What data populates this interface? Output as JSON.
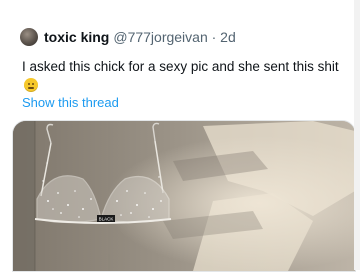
{
  "tweet": {
    "display_name": "toxic king",
    "handle_time": "@777jorgeivan · 2d",
    "text": "I asked this chick for a sexy pic and she sent this shit",
    "show_thread": "Show this thread",
    "emoji_icon": "slightly-frowning-face-icon"
  },
  "media": {
    "description_icon": "photo-bra-on-door",
    "tag_text": "BLACK"
  },
  "colors": {
    "link": "#1d9bf0",
    "name": "#0f1419",
    "meta": "#536471"
  }
}
